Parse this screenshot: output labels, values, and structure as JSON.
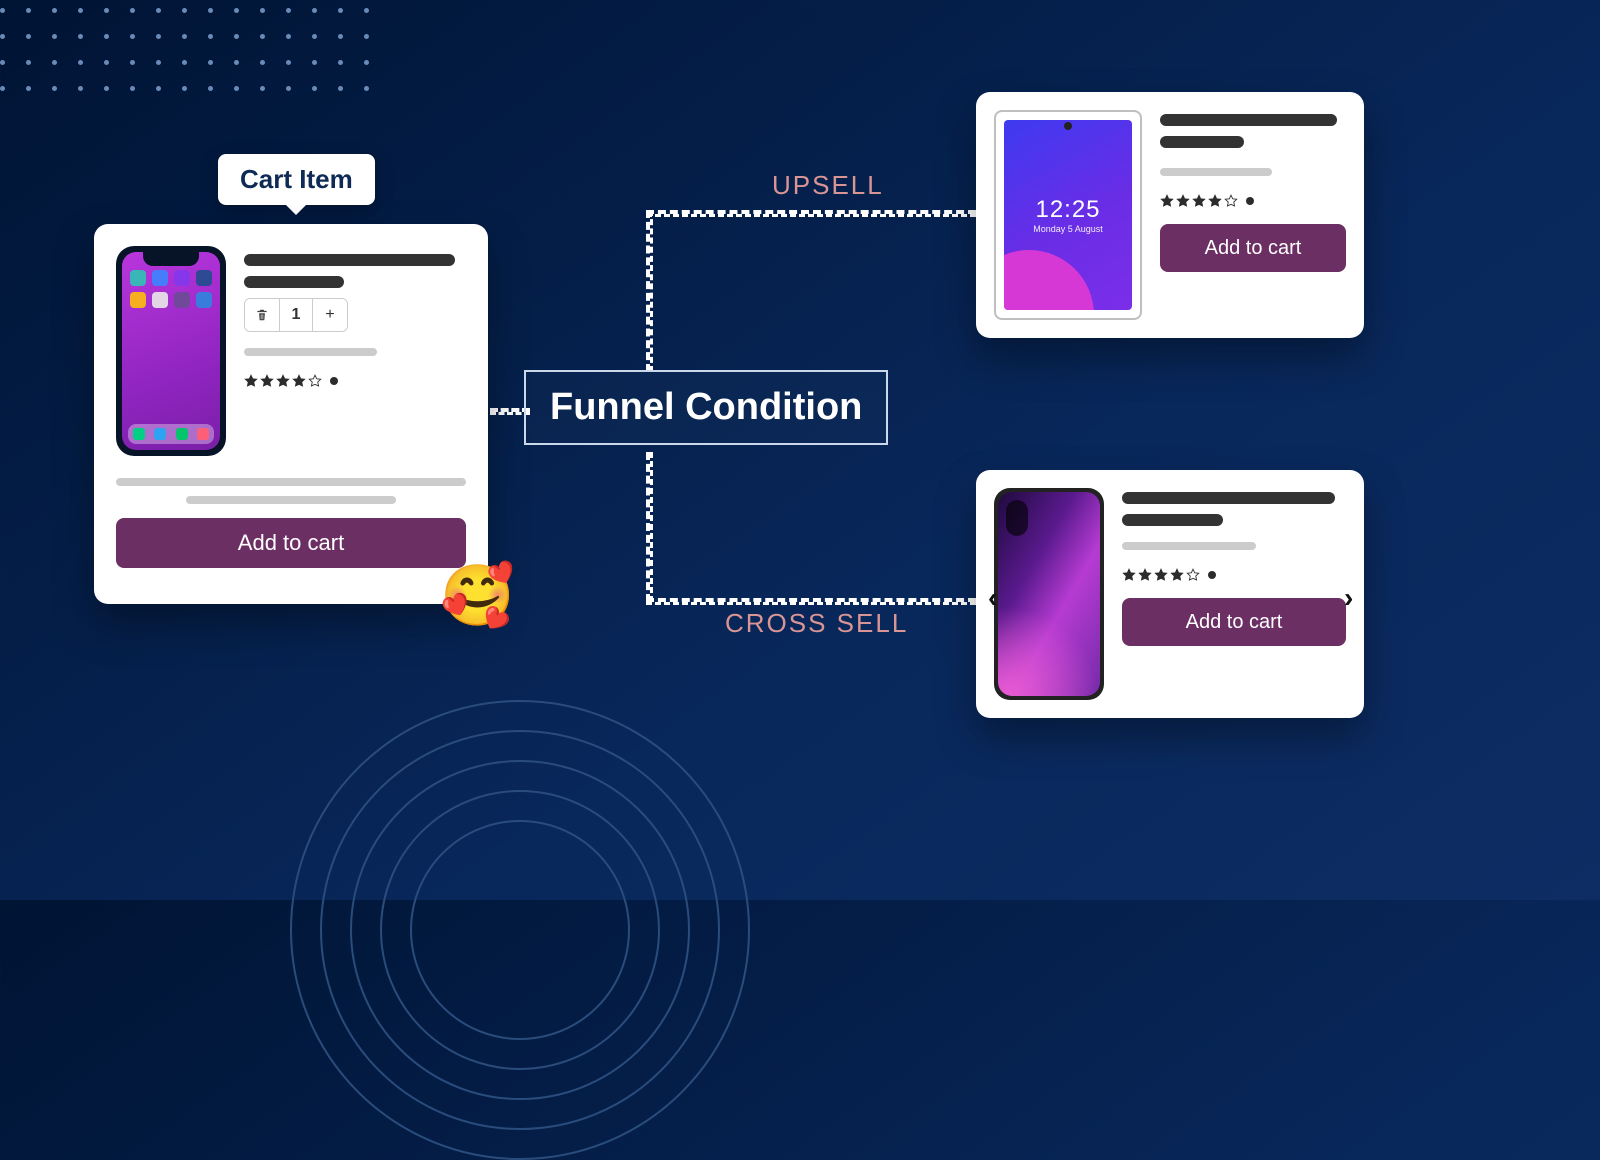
{
  "cart_item": {
    "label": "Cart Item",
    "qty_value": "1",
    "rating_filled": 4,
    "rating_total": 5,
    "add_to_cart": "Add to cart",
    "device_time": "",
    "device_date": ""
  },
  "funnel": {
    "title": "Funnel Condition",
    "upsell_label": "UPSELL",
    "cross_sell_label": "CROSS SELL"
  },
  "upsell": {
    "add_to_cart": "Add to cart",
    "rating_filled": 4,
    "rating_total": 5,
    "device_time": "12:25",
    "device_date": "Monday 5 August"
  },
  "cross_sell": {
    "add_to_cart": "Add to cart",
    "rating_filled": 4,
    "rating_total": 5
  },
  "icons": {
    "emoji": "🥰",
    "chev_left": "‹",
    "chev_right": "›",
    "minus": "−",
    "plus": "+"
  },
  "colors": {
    "button": "#6b2f64",
    "accent_text": "#d99494",
    "bg_start": "#001434",
    "bg_end": "#0d2d64"
  }
}
